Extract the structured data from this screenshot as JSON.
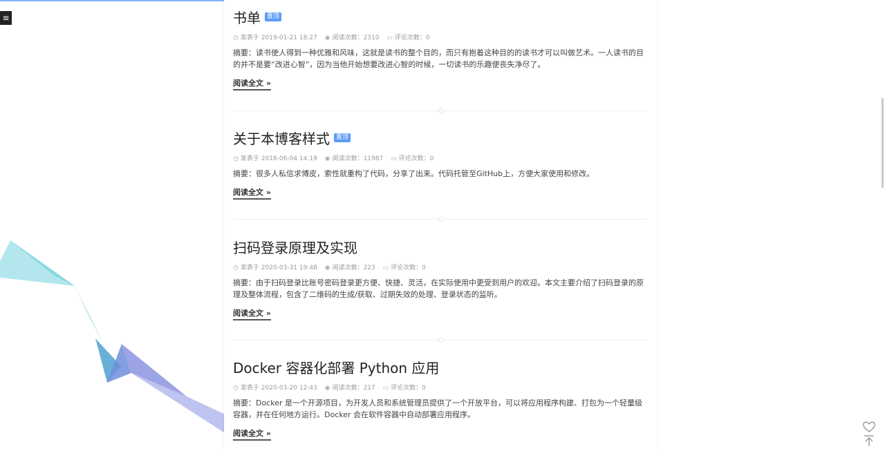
{
  "menu_icon": "hamburger-icon",
  "posts": [
    {
      "title": "书单",
      "pin_label": "置顶",
      "date_label": "发表于 2019-01-21 18:27",
      "views_label": "阅读次数：2310",
      "comments_label": "评论次数：0",
      "summary": "摘要：读书使人得到一种优雅和风味，这就是读书的整个目的，而只有抱着这种目的的读书才可以叫做艺术。一人读书的目的并不是要“改进心智”，因为当他开始想要改进心智的时候，一切读书的乐趣便丧失净尽了。",
      "read_more": "阅读全文 »"
    },
    {
      "title": "关于本博客样式",
      "pin_label": "置顶",
      "date_label": "发表于 2018-06-04 14:19",
      "views_label": "阅读次数：11987",
      "comments_label": "评论次数：0",
      "summary": "摘要：很多人私信求博皮，索性就重构了代码，分享了出来。代码托管至GitHub上，方便大家使用和修改。",
      "read_more": "阅读全文 »"
    },
    {
      "title": "扫码登录原理及实现",
      "date_label": "发表于 2020-03-31 19:48",
      "views_label": "阅读次数：223",
      "comments_label": "评论次数：0",
      "summary": "摘要：由于扫码登录比账号密码登录更方便、快捷、灵活，在实际使用中更受到用户的欢迎。本文主要介绍了扫码登录的原理及整体流程，包含了二维码的生成/获取、过期失效的处理、登录状态的监听。",
      "read_more": "阅读全文 »"
    },
    {
      "title": "Docker 容器化部署 Python 应用",
      "date_label": "发表于 2020-03-20 12:43",
      "views_label": "阅读次数：217",
      "comments_label": "评论次数：0",
      "summary": "摘要：Docker 是一个开源项目，为开发人员和系统管理员提供了一个开放平台，可以将应用程序构建、打包为一个轻量级容器，并在任何地方运行。Docker 会在软件容器中自动部署应用程序。",
      "read_more": "阅读全文 »"
    }
  ],
  "float_icons": {
    "like": "heart-icon",
    "top": "back-to-top-icon"
  },
  "colors": {
    "accent": "#5b9bf8",
    "ribbon_cyan": "#7fd6e0",
    "ribbon_blue": "#5a9ad0",
    "ribbon_violet": "#8c94e0"
  }
}
